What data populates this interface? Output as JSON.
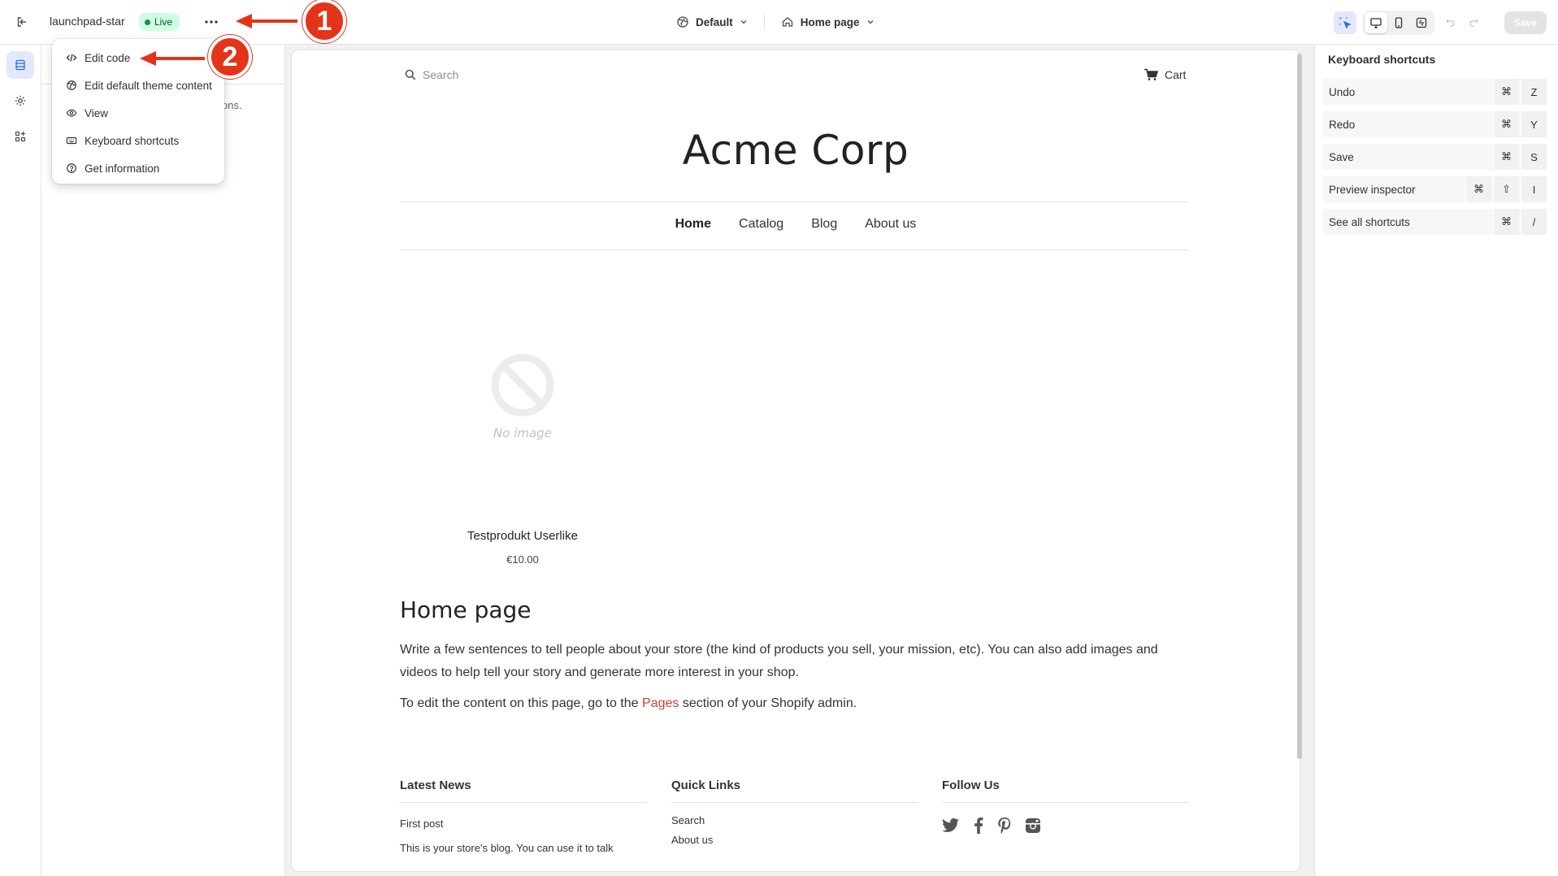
{
  "topbar": {
    "theme_name": "launchpad-star",
    "live_badge": "Live",
    "template_selector": "Default",
    "page_selector": "Home page",
    "save_label": "Save"
  },
  "left_panel": {
    "fragment_text": "ons."
  },
  "menu": {
    "items": [
      {
        "label": "Edit code",
        "icon": "code-icon"
      },
      {
        "label": "Edit default theme content",
        "icon": "globe-icon"
      },
      {
        "label": "View",
        "icon": "eye-icon"
      },
      {
        "label": "Keyboard shortcuts",
        "icon": "keyboard-icon"
      },
      {
        "label": "Get information",
        "icon": "question-circle-icon"
      }
    ]
  },
  "store": {
    "search_placeholder": "Search",
    "cart_label": "Cart",
    "title": "Acme Corp",
    "nav": [
      "Home",
      "Catalog",
      "Blog",
      "About us"
    ],
    "product": {
      "no_image_label": "No image",
      "name": "Testprodukt Userlike",
      "price": "€10.00"
    },
    "page_heading": "Home page",
    "paragraph1": "Write a few sentences to tell people about your store (the kind of products you sell, your mission, etc). You can also add images and videos to help tell your story and generate more interest in your shop.",
    "paragraph2_before": "To edit the content on this page, go to the ",
    "paragraph2_link": "Pages",
    "paragraph2_after": " section of your Shopify admin.",
    "footer": {
      "latest_news": {
        "heading": "Latest News",
        "post_title": "First post",
        "post_excerpt": "This is your store's blog. You can use it to talk"
      },
      "quick_links": {
        "heading": "Quick Links",
        "links": [
          "Search",
          "About us"
        ]
      },
      "follow_us": {
        "heading": "Follow Us",
        "icons": [
          "twitter-icon",
          "facebook-icon",
          "pinterest-icon",
          "instagram-icon"
        ]
      }
    }
  },
  "right_panel": {
    "title": "Keyboard shortcuts",
    "shortcuts": [
      {
        "label": "Undo",
        "keys": [
          "⌘",
          "Z"
        ]
      },
      {
        "label": "Redo",
        "keys": [
          "⌘",
          "Y"
        ]
      },
      {
        "label": "Save",
        "keys": [
          "⌘",
          "S"
        ]
      },
      {
        "label": "Preview inspector",
        "keys": [
          "⌘",
          "⇧",
          "I"
        ]
      },
      {
        "label": "See all shortcuts",
        "keys": [
          "⌘",
          "/"
        ]
      }
    ]
  },
  "annotations": {
    "step1": "1",
    "step2": "2"
  },
  "colors": {
    "accent_red": "#e5331a",
    "live_green_bg": "#cdfee1",
    "live_green_dot": "#29845a",
    "link_red": "#d13f2a",
    "active_blue_bg": "#e3e8ff"
  }
}
